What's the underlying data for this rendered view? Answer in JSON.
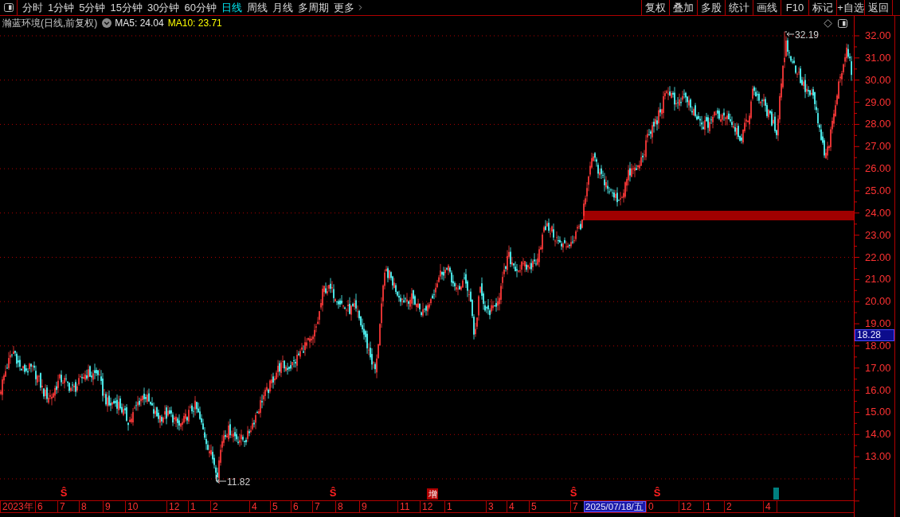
{
  "toolbar": {
    "period_tabs": [
      {
        "label": "分时",
        "kind": "period",
        "selected": false
      },
      {
        "label": "1分钟",
        "kind": "period",
        "selected": false
      },
      {
        "label": "5分钟",
        "kind": "period",
        "selected": false
      },
      {
        "label": "15分钟",
        "kind": "period",
        "selected": false
      },
      {
        "label": "30分钟",
        "kind": "period",
        "selected": false
      },
      {
        "label": "60分钟",
        "kind": "period",
        "selected": false
      },
      {
        "label": "日线",
        "kind": "period",
        "selected": true
      },
      {
        "label": "周线",
        "kind": "period",
        "selected": false
      },
      {
        "label": "月线",
        "kind": "period",
        "selected": false
      },
      {
        "label": "多周期",
        "kind": "period",
        "selected": false
      },
      {
        "label": "更多",
        "kind": "menu",
        "selected": false
      }
    ],
    "buttons": [
      "复权",
      "叠加",
      "多股",
      "统计",
      "画线",
      "F10",
      "标记",
      "+自选",
      "返回"
    ]
  },
  "info_bar": {
    "title": "瀚蓝环境(日线,前复权)",
    "indicators": [
      {
        "label": "MA5: 24.04",
        "color": "#e6e6e6"
      },
      {
        "label": "MA10: 23.71",
        "color": "#ffff00"
      }
    ]
  },
  "chart": {
    "high_label": "32.19",
    "low_label": "11.82",
    "markers": [
      {
        "kind": "signal",
        "label": "Ŝ"
      },
      {
        "kind": "signal",
        "label": "Ŝ"
      },
      {
        "kind": "tag",
        "label": "增"
      },
      {
        "kind": "signal",
        "label": "Ŝ"
      },
      {
        "kind": "signal",
        "label": "Ŝ"
      },
      {
        "kind": "note"
      }
    ]
  },
  "price_axis": {
    "labels": [
      "32.00",
      "31.00",
      "30.00",
      "29.00",
      "28.00",
      "27.00",
      "26.00",
      "25.00",
      "24.00",
      "23.00",
      "22.00",
      "21.00",
      "20.00",
      "19.00",
      "18.00",
      "17.00",
      "16.00",
      "15.00",
      "14.00",
      "13.00"
    ],
    "current_price": "18.28"
  },
  "time_axis": [
    {
      "kind": "month",
      "label": "2023年"
    },
    {
      "kind": "month",
      "label": "6"
    },
    {
      "kind": "month",
      "label": "7"
    },
    {
      "kind": "month",
      "label": "8"
    },
    {
      "kind": "month",
      "label": "9"
    },
    {
      "kind": "month",
      "label": "10"
    },
    {
      "kind": "month",
      "label": "12"
    },
    {
      "kind": "month",
      "label": "1"
    },
    {
      "kind": "month",
      "label": "2"
    },
    {
      "kind": "month",
      "label": "4"
    },
    {
      "kind": "month",
      "label": "5"
    },
    {
      "kind": "month",
      "label": "6"
    },
    {
      "kind": "month",
      "label": "7"
    },
    {
      "kind": "month",
      "label": "8"
    },
    {
      "kind": "month",
      "label": "9"
    },
    {
      "kind": "month",
      "label": "11"
    },
    {
      "kind": "month",
      "label": "12"
    },
    {
      "kind": "month",
      "label": "1"
    },
    {
      "kind": "month",
      "label": "3"
    },
    {
      "kind": "month",
      "label": "4"
    },
    {
      "kind": "month",
      "label": "5"
    },
    {
      "kind": "month",
      "label": "7"
    },
    {
      "kind": "cursor",
      "label": "2025/07/18/五"
    },
    {
      "kind": "month",
      "label": "0"
    },
    {
      "kind": "month",
      "label": "12"
    },
    {
      "kind": "month",
      "label": "1"
    },
    {
      "kind": "month",
      "label": "2"
    },
    {
      "kind": "month",
      "label": "4"
    }
  ]
}
